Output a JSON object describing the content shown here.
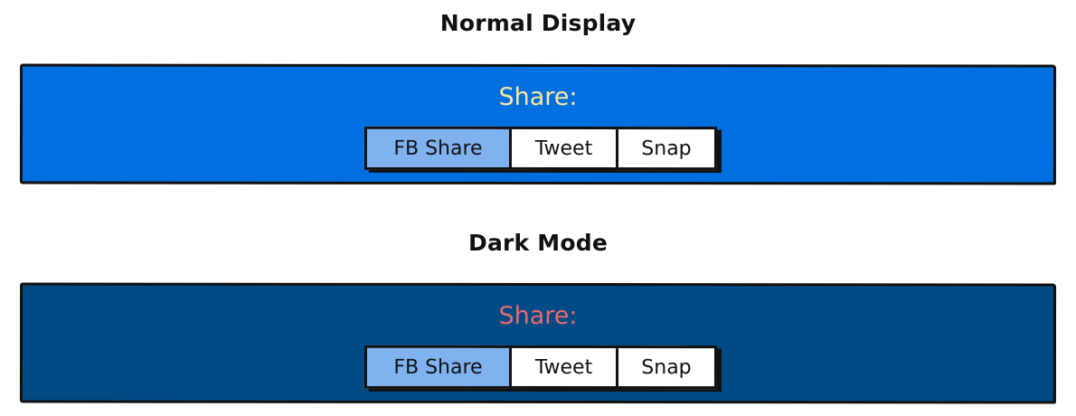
{
  "colors": {
    "normal_panel_bg": "#0070e0",
    "dark_panel_bg": "#004a85",
    "normal_share_text": "#ffe6a0",
    "dark_share_text": "#e96a6a",
    "fb_active_bg": "#7fb2ef",
    "button_bg": "#ffffff",
    "border": "#111111"
  },
  "normal": {
    "title": "Normal Display",
    "share_label": "Share:",
    "buttons": {
      "fb": "FB Share",
      "tweet": "Tweet",
      "snap": "Snap"
    },
    "active_button": "FB Share"
  },
  "dark": {
    "title": "Dark Mode",
    "share_label": "Share:",
    "buttons": {
      "fb": "FB Share",
      "tweet": "Tweet",
      "snap": "Snap"
    },
    "active_button": "FB Share"
  }
}
